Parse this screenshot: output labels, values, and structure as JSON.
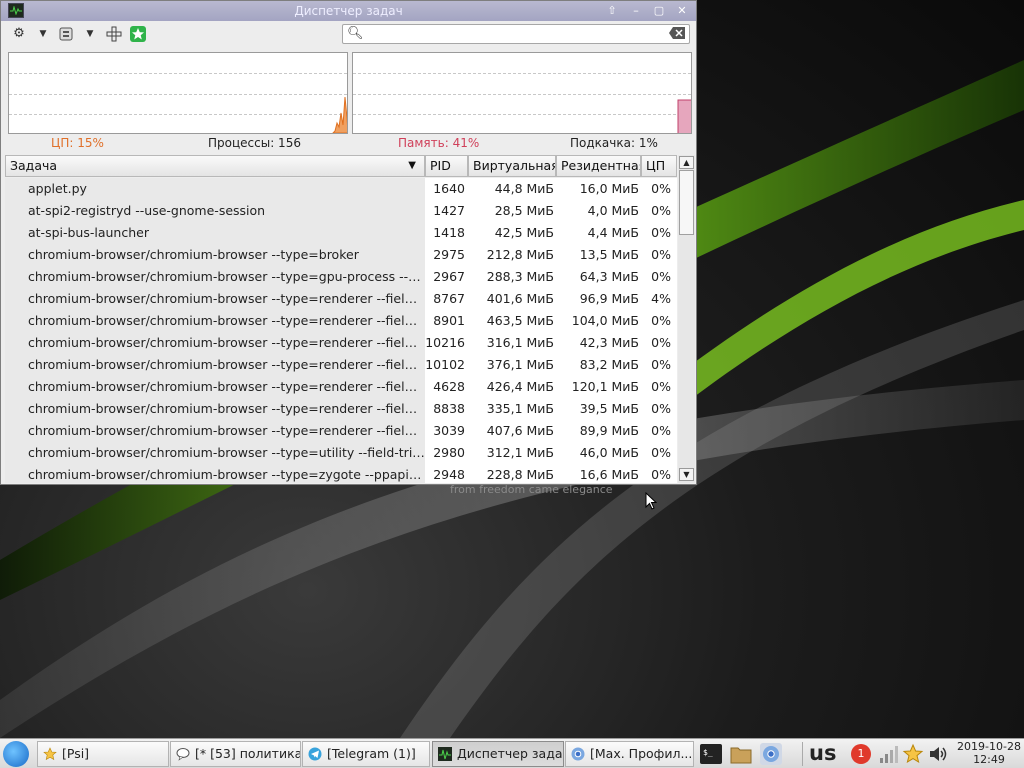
{
  "window": {
    "title": "Диспетчер задач",
    "search": {
      "value": "",
      "placeholder": ""
    }
  },
  "stats": {
    "cpu": "ЦП: 15%",
    "processes": "Процессы: 156",
    "memory": "Память: 41%",
    "swap": "Подкачка: 1%",
    "cpu_color": "#e0702a",
    "memory_color": "#d0405a"
  },
  "table": {
    "columns": [
      "Задача",
      "PID",
      "Виртуальная",
      "Резидентная",
      "ЦП"
    ],
    "rows": [
      {
        "name": "applet.py",
        "pid": "1640",
        "virt": "44,8 МиБ",
        "res": "16,0 МиБ",
        "cpu": "0%"
      },
      {
        "name": "at-spi2-registryd --use-gnome-session",
        "pid": "1427",
        "virt": "28,5 МиБ",
        "res": "4,0 МиБ",
        "cpu": "0%"
      },
      {
        "name": "at-spi-bus-launcher",
        "pid": "1418",
        "virt": "42,5 МиБ",
        "res": "4,4 МиБ",
        "cpu": "0%"
      },
      {
        "name": "chromium-browser/chromium-browser --type=broker",
        "pid": "2975",
        "virt": "212,8 МиБ",
        "res": "13,5 МиБ",
        "cpu": "0%"
      },
      {
        "name": "chromium-browser/chromium-browser --type=gpu-process --field...",
        "pid": "2967",
        "virt": "288,3 МиБ",
        "res": "64,3 МиБ",
        "cpu": "0%"
      },
      {
        "name": "chromium-browser/chromium-browser --type=renderer --field-tri...",
        "pid": "8767",
        "virt": "401,6 МиБ",
        "res": "96,9 МиБ",
        "cpu": "4%"
      },
      {
        "name": "chromium-browser/chromium-browser --type=renderer --field-tri...",
        "pid": "8901",
        "virt": "463,5 МиБ",
        "res": "104,0 МиБ",
        "cpu": "0%"
      },
      {
        "name": "chromium-browser/chromium-browser --type=renderer --field-tri...",
        "pid": "10216",
        "virt": "316,1 МиБ",
        "res": "42,3 МиБ",
        "cpu": "0%"
      },
      {
        "name": "chromium-browser/chromium-browser --type=renderer --field-tri...",
        "pid": "10102",
        "virt": "376,1 МиБ",
        "res": "83,2 МиБ",
        "cpu": "0%"
      },
      {
        "name": "chromium-browser/chromium-browser --type=renderer --field-tri...",
        "pid": "4628",
        "virt": "426,4 МиБ",
        "res": "120,1 МиБ",
        "cpu": "0%"
      },
      {
        "name": "chromium-browser/chromium-browser --type=renderer --field-tri...",
        "pid": "8838",
        "virt": "335,1 МиБ",
        "res": "39,5 МиБ",
        "cpu": "0%"
      },
      {
        "name": "chromium-browser/chromium-browser --type=renderer --field-tri...",
        "pid": "3039",
        "virt": "407,6 МиБ",
        "res": "89,9 МиБ",
        "cpu": "0%"
      },
      {
        "name": "chromium-browser/chromium-browser --type=utility --field-trial-h...",
        "pid": "2980",
        "virt": "312,1 МиБ",
        "res": "46,0 МиБ",
        "cpu": "0%"
      },
      {
        "name": "chromium-browser/chromium-browser --type=zygote --ppapi-flas...",
        "pid": "2948",
        "virt": "228,8 МиБ",
        "res": "16,6 МиБ",
        "cpu": "0%"
      }
    ]
  },
  "desktop": {
    "slogan": "from freedom came elegance"
  },
  "taskbar": {
    "tasks": [
      {
        "label": "[Psi]",
        "icon": "star-icon"
      },
      {
        "label": "[* [53] политика]",
        "icon": "chat-bubble-icon"
      },
      {
        "label": "[Telegram (1)]",
        "icon": "telegram-icon"
      },
      {
        "label": "Диспетчер задач",
        "icon": "task-manager-icon",
        "active": true
      },
      {
        "label": "[Max. Профил...",
        "icon": "chromium-icon"
      }
    ],
    "keyboard_layout": "us",
    "notification_count": "1",
    "clock": {
      "date": "2019-10-28",
      "time": "12:49"
    }
  }
}
